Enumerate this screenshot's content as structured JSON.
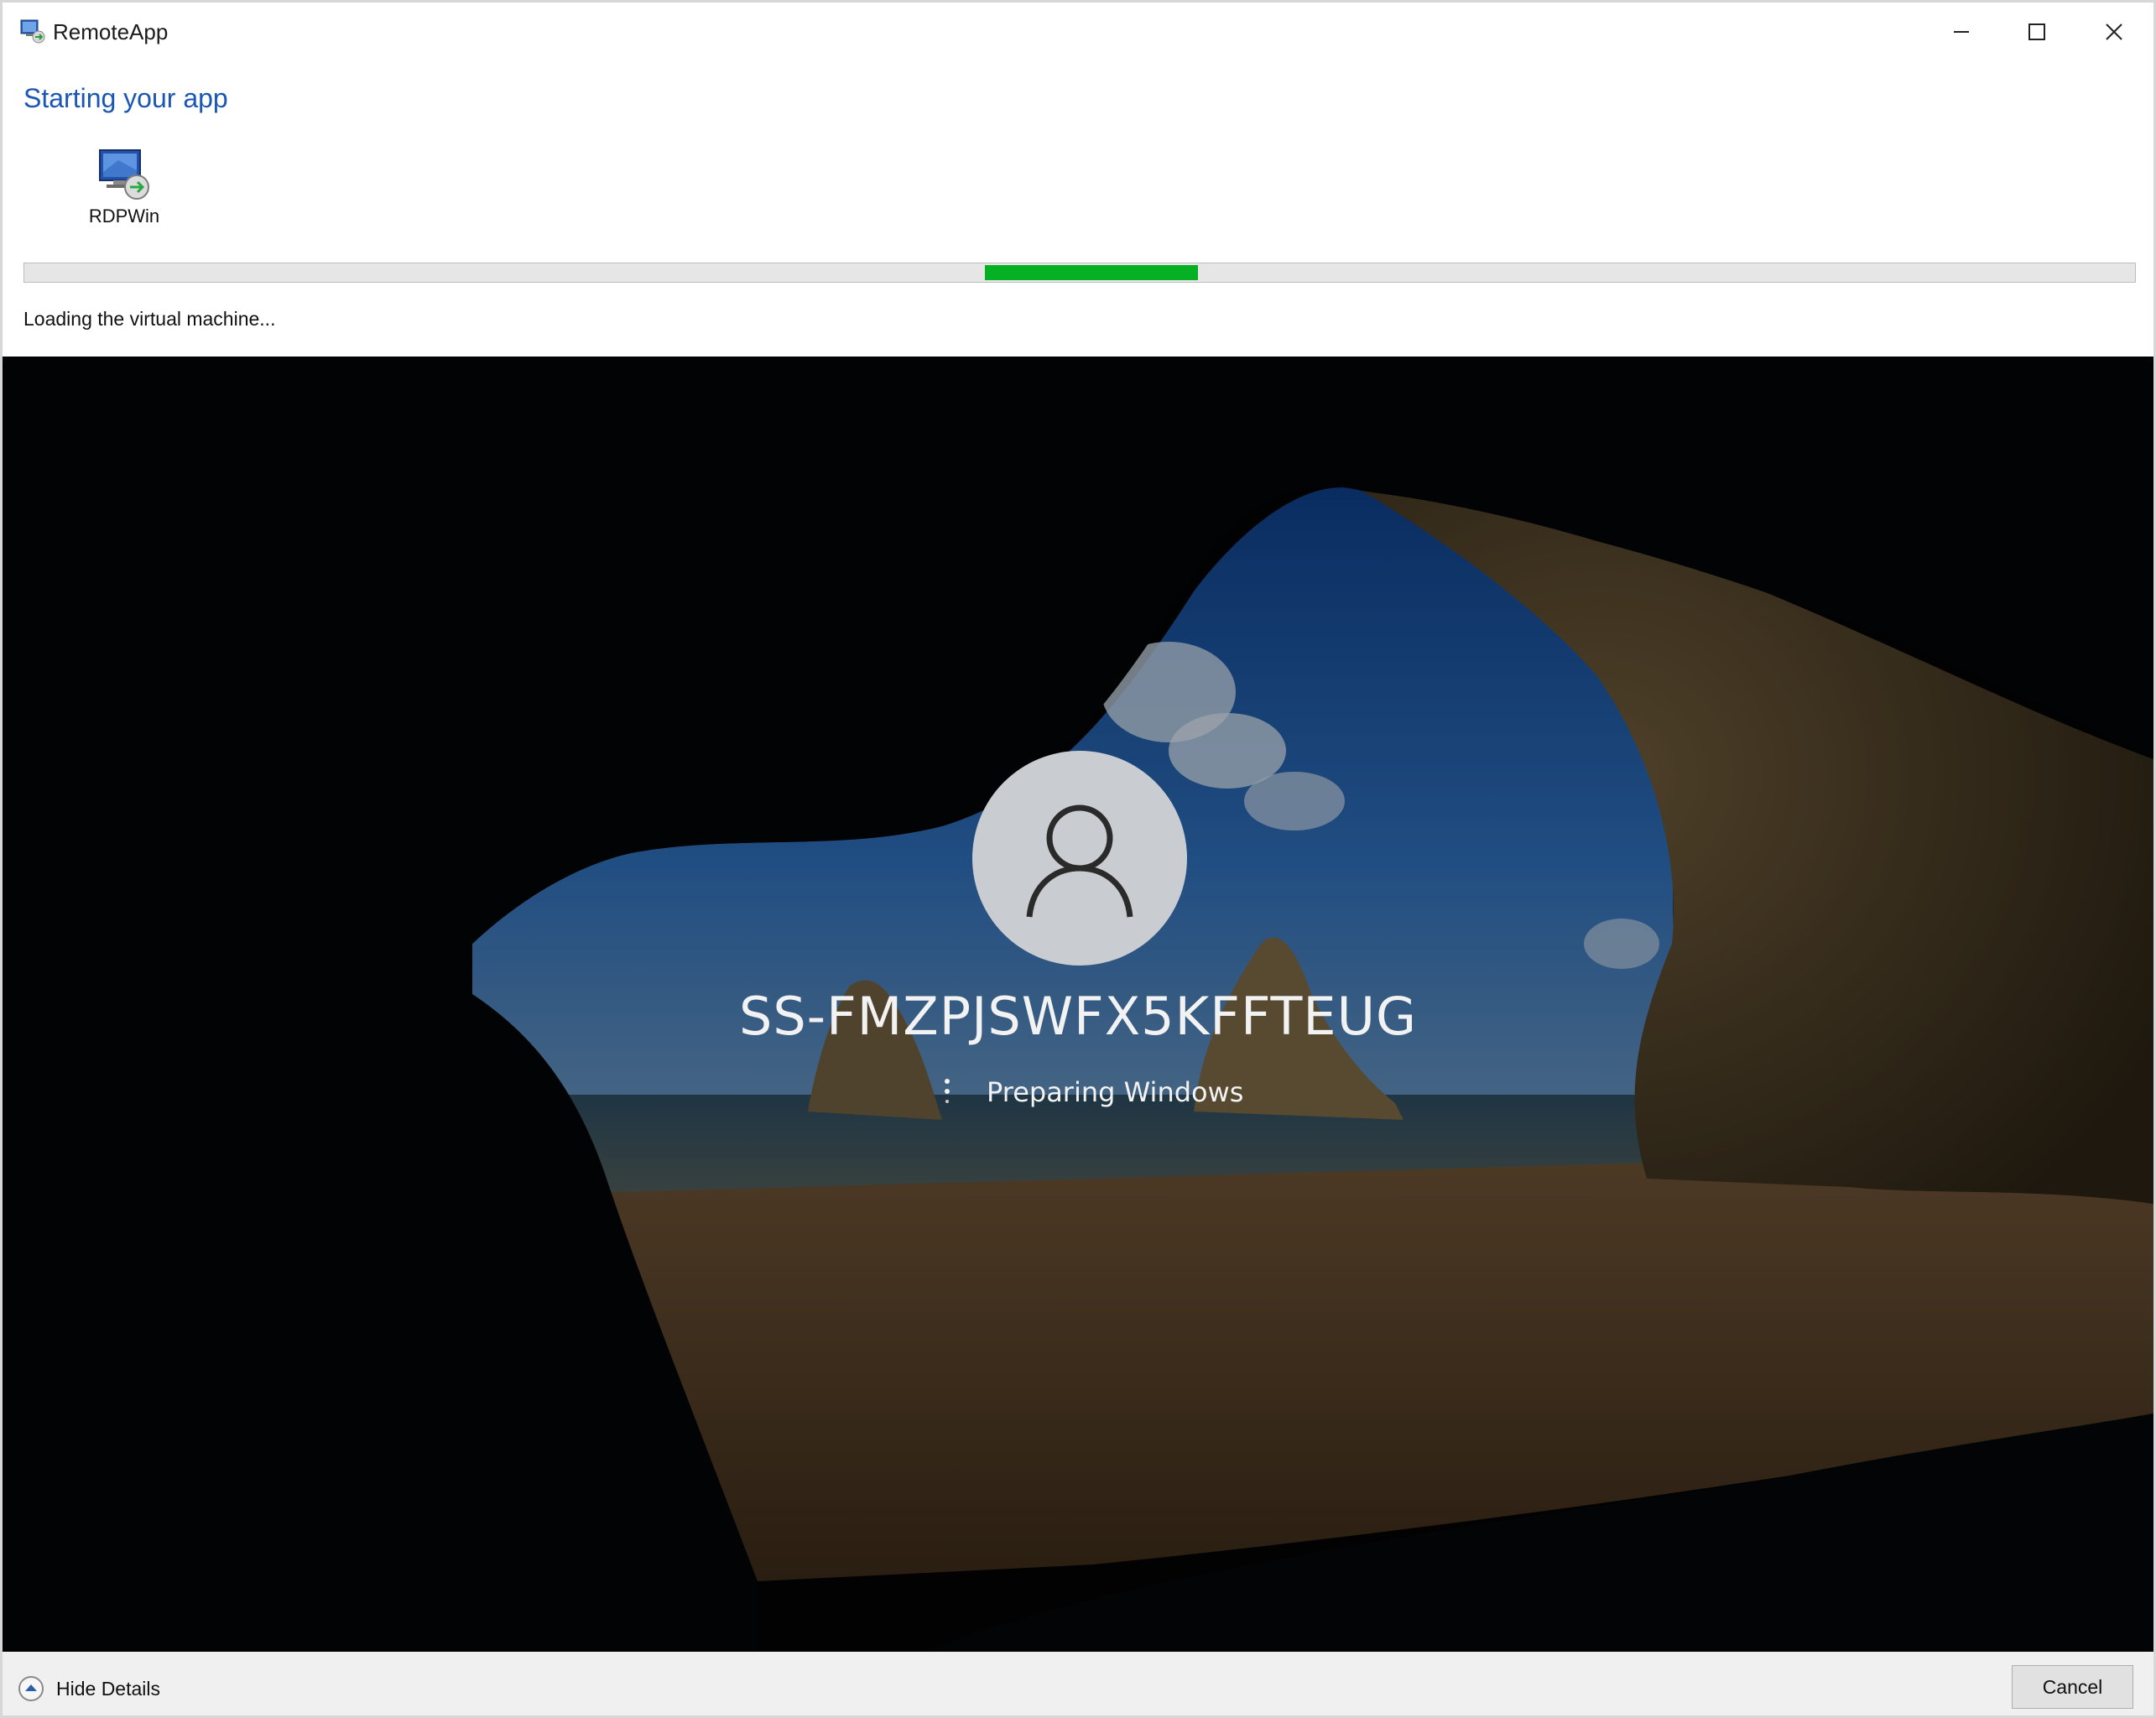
{
  "window": {
    "title": "RemoteApp",
    "controls": {
      "minimize": "minimize-icon",
      "maximize": "maximize-icon",
      "close": "close-icon"
    }
  },
  "header": {
    "heading": "Starting your app",
    "app": {
      "label": "RDPWin",
      "icon": "remote-desktop-icon"
    }
  },
  "progress": {
    "start_fraction": 0.455,
    "end_fraction": 0.556,
    "color": "#06b025"
  },
  "status_text": "Loading the virtual machine...",
  "vm": {
    "machine_name": "SS-FMZPJSWFX5KFFTEUG",
    "status": "Preparing Windows",
    "avatar_icon": "user-icon"
  },
  "footer": {
    "hide_details_label": "Hide Details",
    "hide_details_icon": "chevron-up-circle-icon",
    "cancel_label": "Cancel"
  },
  "colors": {
    "heading": "#1a56b3",
    "progress": "#06b025"
  }
}
